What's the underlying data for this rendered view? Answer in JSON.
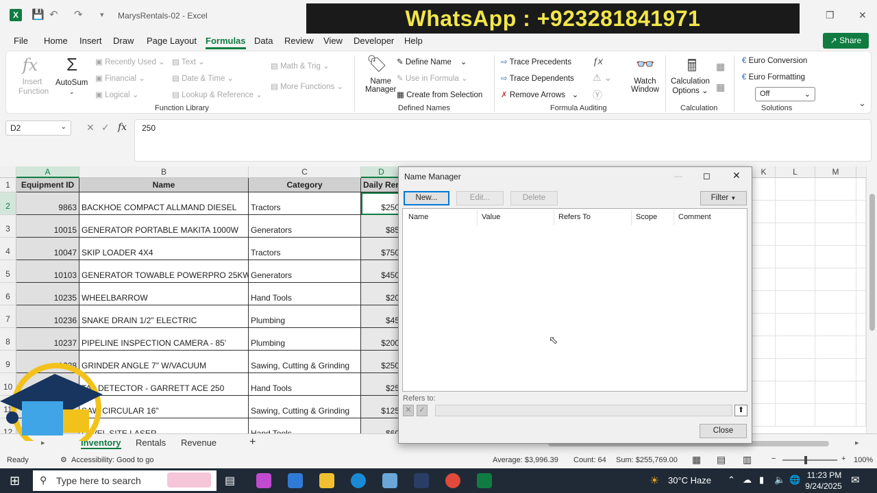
{
  "titlebar": {
    "doc_title": "MarysRentals-02  -  Excel",
    "app_letter": "X"
  },
  "banner": {
    "text": "WhatsApp : +923281841971"
  },
  "menu": {
    "tabs": [
      "File",
      "Home",
      "Insert",
      "Draw",
      "Page Layout",
      "Formulas",
      "Data",
      "Review",
      "View",
      "Developer",
      "Help"
    ],
    "active": "Formulas",
    "share_label": "Share"
  },
  "ribbon": {
    "insert_function": "Insert\nFunction",
    "autosum": "AutoSum",
    "recently_used": "Recently Used",
    "financial": "Financial",
    "logical": "Logical",
    "text": "Text",
    "date_time": "Date & Time",
    "lookup_reference": "Lookup & Reference",
    "math_trig": "Math & Trig",
    "more_functions": "More Functions",
    "function_library": "Function Library",
    "name_manager_1": "Name",
    "name_manager_2": "Manager",
    "define_name": "Define Name",
    "use_in_formula": "Use in Formula",
    "create_from_selection": "Create from Selection",
    "defined_names": "Defined Names",
    "trace_precedents": "Trace Precedents",
    "trace_dependents": "Trace Dependents",
    "remove_arrows": "Remove Arrows",
    "formula_auditing": "Formula Auditing",
    "watch_window_1": "Watch",
    "watch_window_2": "Window",
    "calculation_options_1": "Calculation",
    "calculation_options_2": "Options",
    "calculation": "Calculation",
    "euro_conversion": "Euro Conversion",
    "euro_formatting": "Euro Formatting",
    "off": "Off",
    "solutions": "Solutions"
  },
  "formula_bar": {
    "name_box": "D2",
    "fx": "fx",
    "value": "250"
  },
  "grid": {
    "columns": [
      "A",
      "B",
      "C",
      "D",
      "K",
      "L",
      "M"
    ],
    "header": [
      "Equipment ID",
      "Name",
      "Category",
      "Daily Rer"
    ],
    "rows": [
      {
        "n": "2",
        "id": "9863",
        "name": "BACKHOE COMPACT ALLMAND DIESEL",
        "cat": "Tractors",
        "rate": "$250"
      },
      {
        "n": "3",
        "id": "10015",
        "name": "GENERATOR PORTABLE MAKITA 1000W",
        "cat": "Generators",
        "rate": "$85"
      },
      {
        "n": "4",
        "id": "10047",
        "name": "SKIP LOADER 4X4",
        "cat": "Tractors",
        "rate": "$750"
      },
      {
        "n": "5",
        "id": "10103",
        "name": "GENERATOR TOWABLE POWERPRO 25KW",
        "cat": "Generators",
        "rate": "$450"
      },
      {
        "n": "6",
        "id": "10235",
        "name": "WHEELBARROW",
        "cat": "Hand Tools",
        "rate": "$20"
      },
      {
        "n": "7",
        "id": "10236",
        "name": "SNAKE DRAIN 1/2\" ELECTRIC",
        "cat": "Plumbing",
        "rate": "$45"
      },
      {
        "n": "8",
        "id": "10237",
        "name": "PIPELINE INSPECTION CAMERA - 85'",
        "cat": "Plumbing",
        "rate": "$200"
      },
      {
        "n": "9",
        "id": "1028",
        "name": "GRINDER ANGLE 7\" W/VACUUM",
        "cat": "Sawing, Cutting & Grinding",
        "rate": "$250"
      },
      {
        "n": "10",
        "id": "",
        "name": "TAL DETECTOR - GARRETT ACE 250",
        "cat": "Hand Tools",
        "rate": "$25"
      },
      {
        "n": "11",
        "id": "",
        "name": "SAW CIRCULAR 16\"",
        "cat": "Sawing, Cutting & Grinding",
        "rate": "$125"
      },
      {
        "n": "12",
        "id": "",
        "name": "LEVEL SITE LASER",
        "cat": "Hand Tools",
        "rate": "$60"
      }
    ],
    "row1": "1"
  },
  "sheets": {
    "tabs": [
      "Inventory",
      "Rentals",
      "Revenue"
    ],
    "active": "Inventory",
    "add": "+"
  },
  "status": {
    "ready": "Ready",
    "accessibility": "Accessibility: Good to go",
    "average": "Average: $3,996.39",
    "count": "Count: 64",
    "sum": "Sum: $255,769.00",
    "zoom": "100%"
  },
  "taskbar": {
    "search_placeholder": "Type here to search",
    "weather": "30°C  Haze",
    "time": "11:23 PM",
    "date": "9/24/2025"
  },
  "dialog": {
    "title": "Name Manager",
    "new": "New...",
    "edit": "Edit...",
    "delete": "Delete",
    "filter": "Filter",
    "cols": [
      "Name",
      "Value",
      "Refers To",
      "Scope",
      "Comment"
    ],
    "refers_to": "Refers to:",
    "close": "Close"
  },
  "colors": {
    "excel_green": "#107c41",
    "banner_yellow": "#f2e64a"
  }
}
